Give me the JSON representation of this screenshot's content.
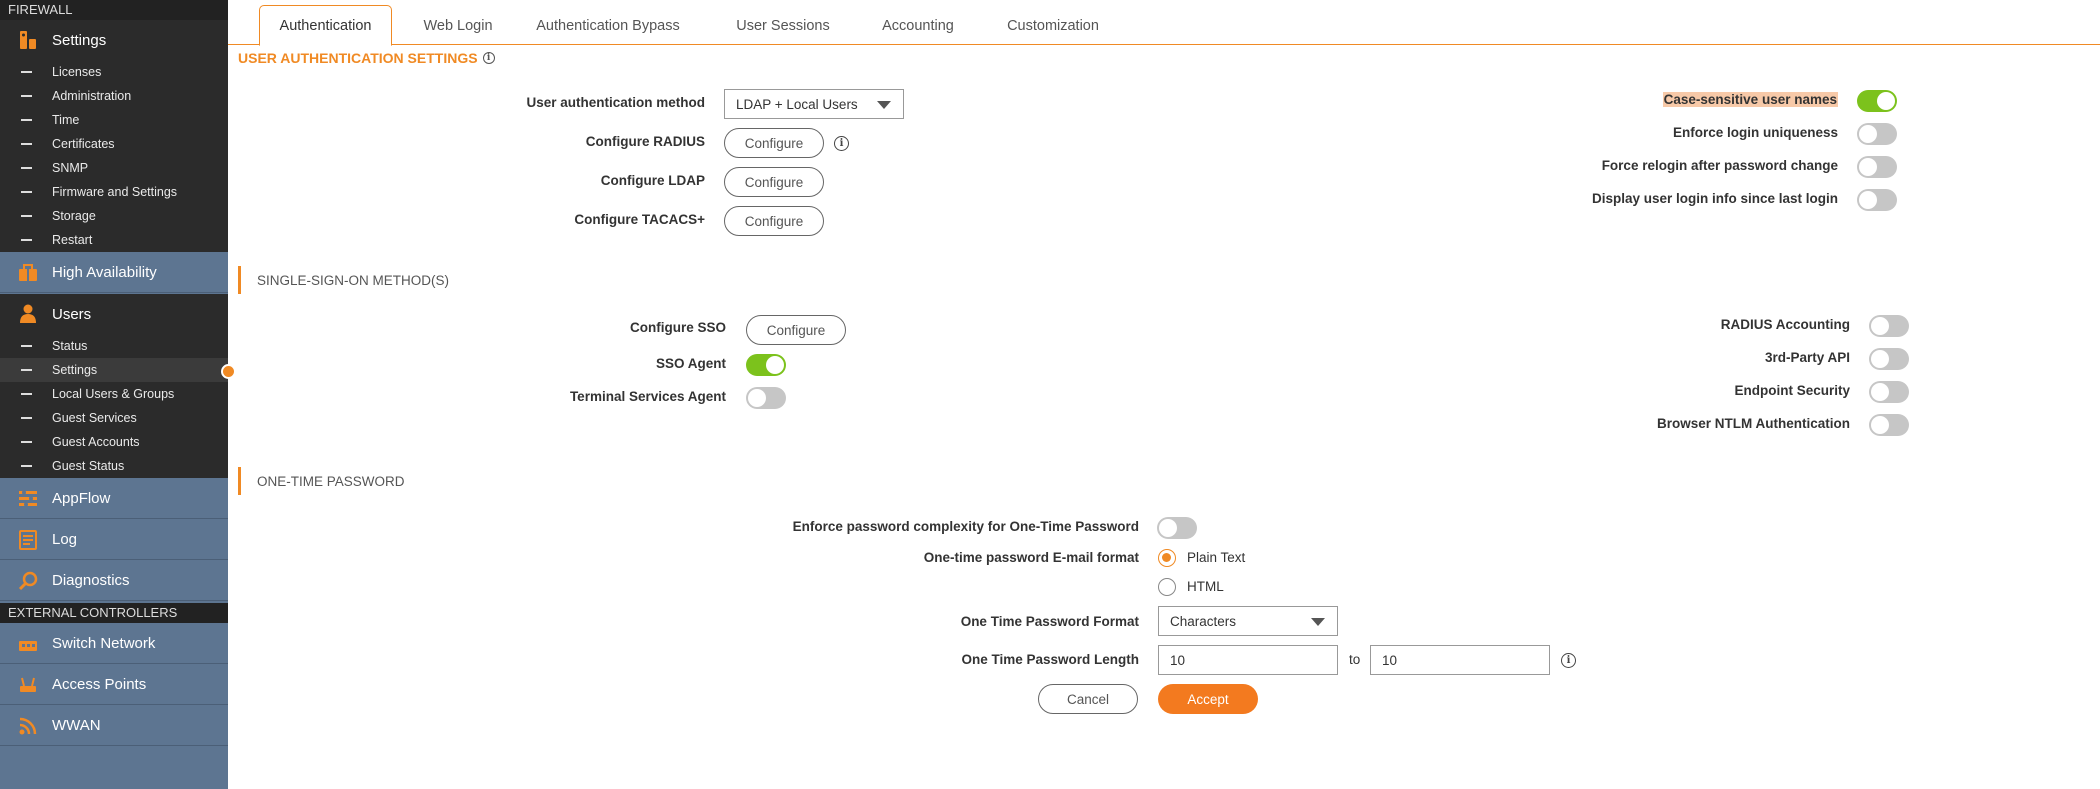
{
  "sidebar": {
    "firewall_header": "FIREWALL",
    "settings": {
      "label": "Settings",
      "icon": "settings-icon"
    },
    "settings_items": [
      "Licenses",
      "Administration",
      "Time",
      "Certificates",
      "SNMP",
      "Firmware and Settings",
      "Storage",
      "Restart"
    ],
    "high_availability": {
      "label": "High Availability",
      "icon": "high-availability-icon"
    },
    "users": {
      "label": "Users",
      "icon": "user-icon"
    },
    "users_items": [
      "Status",
      "Settings",
      "Local Users & Groups",
      "Guest Services",
      "Guest Accounts",
      "Guest Status"
    ],
    "active_item": "Settings",
    "appflow": {
      "label": "AppFlow",
      "icon": "appflow-icon"
    },
    "log": {
      "label": "Log",
      "icon": "log-icon"
    },
    "diagnostics": {
      "label": "Diagnostics",
      "icon": "diagnostics-icon"
    },
    "external_header": "EXTERNAL CONTROLLERS",
    "switch_network": {
      "label": "Switch Network",
      "icon": "switch-network-icon"
    },
    "access_points": {
      "label": "Access Points",
      "icon": "access-points-icon"
    },
    "wwan": {
      "label": "WWAN",
      "icon": "wwan-icon"
    }
  },
  "tabs": [
    "Authentication",
    "Web Login",
    "Authentication Bypass",
    "User Sessions",
    "Accounting",
    "Customization"
  ],
  "active_tab": "Authentication",
  "user_auth": {
    "title": "USER AUTHENTICATION SETTINGS",
    "method_label": "User authentication method",
    "method_value": "LDAP + Local Users",
    "radius_label": "Configure RADIUS",
    "ldap_label": "Configure LDAP",
    "tacacs_label": "Configure TACACS+",
    "configure_btn": "Configure",
    "case_sensitive_label": "Case-sensitive user names",
    "case_sensitive_on": true,
    "login_uniqueness_label": "Enforce login uniqueness",
    "login_uniqueness_on": false,
    "force_relogin_label": "Force relogin after password change",
    "force_relogin_on": false,
    "display_login_info_label": "Display user login info since last login",
    "display_login_info_on": false
  },
  "sso": {
    "title": "SINGLE-SIGN-ON METHOD(S)",
    "configure_label": "Configure SSO",
    "configure_btn": "Configure",
    "sso_agent_label": "SSO Agent",
    "sso_agent_on": true,
    "terminal_label": "Terminal Services Agent",
    "terminal_on": false,
    "radius_acct_label": "RADIUS Accounting",
    "radius_acct_on": false,
    "third_party_label": "3rd-Party API",
    "third_party_on": false,
    "endpoint_label": "Endpoint Security",
    "endpoint_on": false,
    "ntlm_label": "Browser NTLM Authentication",
    "ntlm_on": false
  },
  "otp": {
    "title": "ONE-TIME PASSWORD",
    "complexity_label": "Enforce password complexity for One-Time Password",
    "complexity_on": false,
    "email_format_label": "One-time password E-mail format",
    "format_plain": "Plain Text",
    "format_html": "HTML",
    "selected_format": "Plain Text",
    "format_label": "One Time Password Format",
    "format_value": "Characters",
    "length_label": "One Time Password Length",
    "length_min": "10",
    "length_to": "to",
    "length_max": "10"
  },
  "actions": {
    "cancel": "Cancel",
    "accept": "Accept"
  },
  "colors": {
    "accent": "#f08a24",
    "toggle_on": "#7cc21c",
    "sidebar": "#5d7591"
  }
}
